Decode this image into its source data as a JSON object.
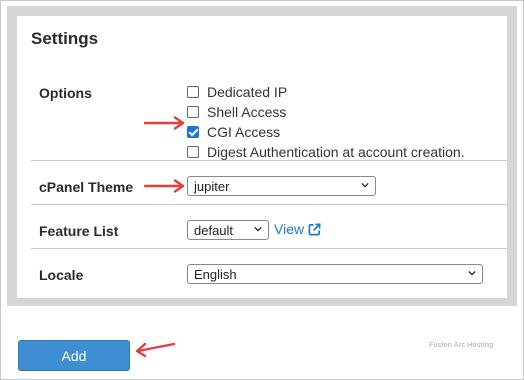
{
  "settings": {
    "title": "Settings",
    "options": {
      "label": "Options",
      "items": [
        {
          "label": "Dedicated IP",
          "checked": false
        },
        {
          "label": "Shell Access",
          "checked": false
        },
        {
          "label": "CGI Access",
          "checked": true
        },
        {
          "label": "Digest Authentication at account creation.",
          "checked": false
        }
      ]
    },
    "cpanel_theme": {
      "label": "cPanel Theme",
      "value": "jupiter"
    },
    "feature_list": {
      "label": "Feature List",
      "value": "default",
      "view_link": "View"
    },
    "locale": {
      "label": "Locale",
      "value": "English"
    }
  },
  "add_button": {
    "label": "Add"
  },
  "watermark": "Fusion Arc Hosting",
  "colors": {
    "accent": "#3d8fd1",
    "arrow": "#e53e3e",
    "link": "#1e7bc4"
  },
  "icons": {
    "external_link": "external-link-icon",
    "chevron": "chevron-down-icon",
    "annotation_arrow": "arrow-icon"
  }
}
